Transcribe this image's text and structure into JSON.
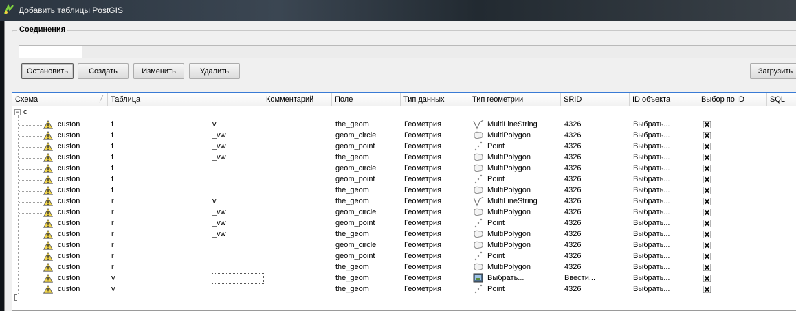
{
  "window": {
    "title": "Добавить таблицы PostGIS"
  },
  "connections": {
    "legend": "Соединения",
    "buttons": {
      "connect": "Остановить",
      "create": "Создать",
      "edit": "Изменить",
      "delete": "Удалить",
      "load": "Загрузить"
    }
  },
  "table": {
    "columns": [
      "Схема",
      "Таблица",
      "Комментарий",
      "Поле",
      "Тип данных",
      "Тип геометрии",
      "SRID",
      "ID объекта",
      "Выбор по ID",
      "SQL"
    ],
    "root_label": "c",
    "rows": [
      {
        "schema": "custon",
        "table": "f",
        "table2": "v",
        "field": "the_geom",
        "dtype": "Геометрия",
        "geom_icon": "line-icon",
        "geom": "MultiLineString",
        "srid": "4326",
        "id": "Выбрать..."
      },
      {
        "schema": "custon",
        "table": "f",
        "table2": "_vw",
        "field": "geom_circle",
        "dtype": "Геометрия",
        "geom_icon": "polygon-icon",
        "geom": "MultiPolygon",
        "srid": "4326",
        "id": "Выбрать..."
      },
      {
        "schema": "custon",
        "table": "f",
        "table2": "_vw",
        "field": "geom_point",
        "dtype": "Геометрия",
        "geom_icon": "point-icon",
        "geom": "Point",
        "srid": "4326",
        "id": "Выбрать..."
      },
      {
        "schema": "custon",
        "table": "f",
        "table2": "_vw",
        "field": "the_geom",
        "dtype": "Геометрия",
        "geom_icon": "polygon-icon",
        "geom": "MultiPolygon",
        "srid": "4326",
        "id": "Выбрать..."
      },
      {
        "schema": "custon",
        "table": "f",
        "table2": "",
        "field": "geom_circle",
        "dtype": "Геометрия",
        "geom_icon": "polygon-icon",
        "geom": "MultiPolygon",
        "srid": "4326",
        "id": "Выбрать..."
      },
      {
        "schema": "custon",
        "table": "f",
        "table2": "",
        "field": "geom_point",
        "dtype": "Геометрия",
        "geom_icon": "point-icon",
        "geom": "Point",
        "srid": "4326",
        "id": "Выбрать..."
      },
      {
        "schema": "custon",
        "table": "f",
        "table2": "",
        "field": "the_geom",
        "dtype": "Геометрия",
        "geom_icon": "polygon-icon",
        "geom": "MultiPolygon",
        "srid": "4326",
        "id": "Выбрать..."
      },
      {
        "schema": "custon",
        "table": "r",
        "table2": "v",
        "field": "the_geom",
        "dtype": "Геометрия",
        "geom_icon": "line-icon",
        "geom": "MultiLineString",
        "srid": "4326",
        "id": "Выбрать..."
      },
      {
        "schema": "custon",
        "table": "r",
        "table2": "_vw",
        "field": "geom_circle",
        "dtype": "Геометрия",
        "geom_icon": "polygon-icon",
        "geom": "MultiPolygon",
        "srid": "4326",
        "id": "Выбрать..."
      },
      {
        "schema": "custon",
        "table": "r",
        "table2": "_vw",
        "field": "geom_point",
        "dtype": "Геометрия",
        "geom_icon": "point-icon",
        "geom": "Point",
        "srid": "4326",
        "id": "Выбрать..."
      },
      {
        "schema": "custon",
        "table": "r",
        "table2": "_vw",
        "field": "the_geom",
        "dtype": "Геометрия",
        "geom_icon": "polygon-icon",
        "geom": "MultiPolygon",
        "srid": "4326",
        "id": "Выбрать..."
      },
      {
        "schema": "custon",
        "table": "r",
        "table2": "",
        "field": "geom_circle",
        "dtype": "Геометрия",
        "geom_icon": "polygon-icon",
        "geom": "MultiPolygon",
        "srid": "4326",
        "id": "Выбрать..."
      },
      {
        "schema": "custon",
        "table": "r",
        "table2": "",
        "field": "geom_point",
        "dtype": "Геометрия",
        "geom_icon": "point-icon",
        "geom": "Point",
        "srid": "4326",
        "id": "Выбрать..."
      },
      {
        "schema": "custon",
        "table": "r",
        "table2": "",
        "field": "the_geom",
        "dtype": "Геометрия",
        "geom_icon": "polygon-icon",
        "geom": "MultiPolygon",
        "srid": "4326",
        "id": "Выбрать..."
      },
      {
        "schema": "custon",
        "table": "v",
        "table2": "",
        "field": "the_geom",
        "dtype": "Геометрия",
        "geom_icon": "select-icon",
        "geom": "Выбрать...",
        "srid": "Ввести...",
        "id": "Выбрать..."
      },
      {
        "schema": "custon",
        "table": "v",
        "table2": "",
        "field": "the_geom",
        "dtype": "Геометрия",
        "geom_icon": "point-icon",
        "geom": "Point",
        "srid": "4326",
        "id": "Выбрать..."
      }
    ]
  },
  "colors": {
    "accent": "#3a7bd5",
    "warning": "#f2d64b",
    "delete": "#111111"
  }
}
